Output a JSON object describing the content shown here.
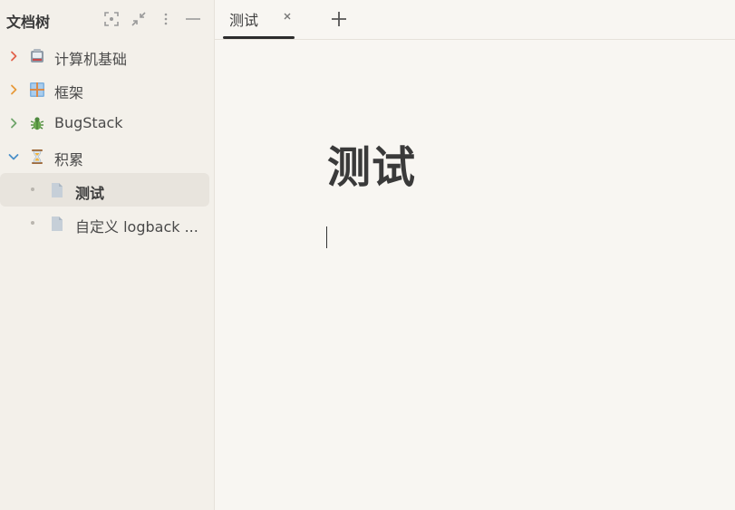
{
  "sidebar": {
    "title": "文档树",
    "tools": [
      {
        "icon": "focus-icon"
      },
      {
        "icon": "collapse-icon"
      },
      {
        "icon": "more-icon"
      },
      {
        "icon": "minimize-icon"
      }
    ],
    "items": [
      {
        "label": "计算机基础",
        "icon": "computer-emoji-icon",
        "expanded": false,
        "chevron_color": "#e2614b"
      },
      {
        "label": "框架",
        "icon": "window-emoji-icon",
        "expanded": false,
        "chevron_color": "#e79a3a"
      },
      {
        "label": "BugStack",
        "icon": "bug-emoji-icon",
        "expanded": false,
        "chevron_color": "#6fa56b"
      },
      {
        "label": "积累",
        "icon": "hourglass-emoji-icon",
        "expanded": true,
        "chevron_color": "#4a90c8"
      },
      {
        "label": "测试",
        "icon": "document-icon",
        "selected": true
      },
      {
        "label": "自定义 logback ...",
        "icon": "document-icon"
      }
    ]
  },
  "tabs": [
    {
      "label": "测试",
      "active": true
    }
  ],
  "editor": {
    "title": "测试"
  },
  "colors": {
    "background": "#f8f6f2",
    "sidebar": "#f3f0ea",
    "selected_row": "#e8e4dd"
  }
}
